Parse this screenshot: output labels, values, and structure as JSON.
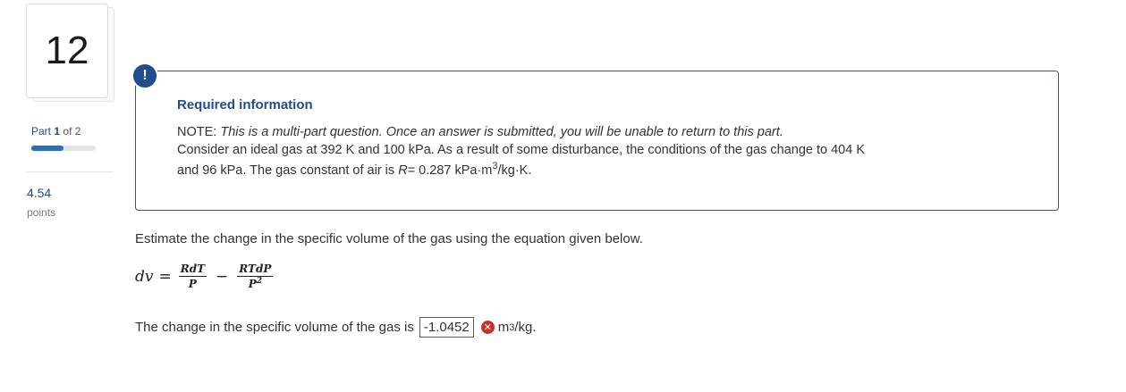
{
  "question": {
    "number": "12"
  },
  "sidebar": {
    "part_word": "Part",
    "part_current": "1",
    "part_of": "of",
    "part_total": "2",
    "progress_fraction": 0.5,
    "points_value": "4.54",
    "points_label": "points"
  },
  "info": {
    "alert_glyph": "!",
    "title": "Required information",
    "note_label": "NOTE:",
    "note_text": "This is a multi-part question. Once an answer is submitted, you will be unable to return to this part.",
    "line1": "Consider an ideal gas at 392 K and 100 kPa. As a result of some disturbance, the conditions of the gas change to 404 K",
    "line2_pre": "and 96 kPa. The gas constant of air is",
    "r_symbol": "R",
    "line2_value": "= 0.287 kPa·m",
    "line2_exp": "3",
    "line2_post": "/kg·K."
  },
  "prompt": "Estimate the change in the specific volume of the gas using the equation given below.",
  "equation": {
    "lhs": "dv",
    "eq": "=",
    "t1_num": "RdT",
    "t1_den": "P",
    "minus": "−",
    "t2_num": "RTdP",
    "t2_den": "P",
    "t2_den_exp": "2"
  },
  "answer": {
    "text": "The change in the specific volume of the gas is",
    "value": "-1.0452",
    "status_icon": "incorrect-icon",
    "unit_base": "m",
    "unit_exp": "3",
    "unit_post": "/kg."
  },
  "colors": {
    "accent": "#1f4e8c",
    "error": "#c9302c",
    "progress": "#2a6fba"
  }
}
